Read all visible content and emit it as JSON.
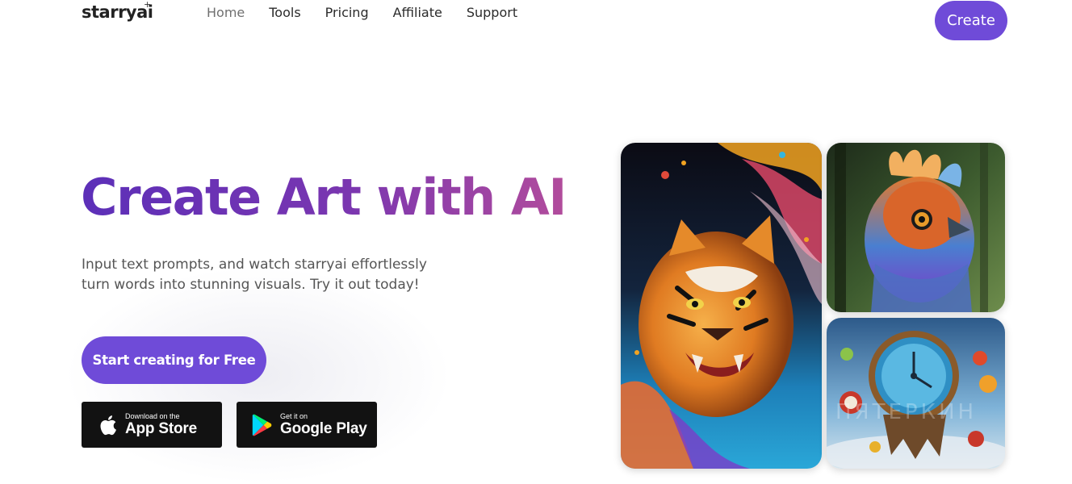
{
  "brand": {
    "name": "starryai",
    "spark": "+"
  },
  "nav": {
    "links": [
      {
        "label": "Home",
        "active": true
      },
      {
        "label": "Tools"
      },
      {
        "label": "Pricing"
      },
      {
        "label": "Affiliate"
      },
      {
        "label": "Support"
      }
    ],
    "cta_label": "Create"
  },
  "hero": {
    "title": "Create Art with AI",
    "description_lines": [
      "Input text prompts, and watch starryai effortlessly",
      "turn words into stunning visuals. Try it out today!"
    ],
    "start_label": "Start creating for Free"
  },
  "stores": {
    "apple": {
      "small": "Download on the",
      "big": "App Store",
      "icon": "apple-icon"
    },
    "google": {
      "small": "Get it on",
      "big": "Google Play",
      "icon": "google-play-icon"
    }
  },
  "gallery": [
    {
      "subject": "tiger-artwork"
    },
    {
      "subject": "bird-artwork"
    },
    {
      "subject": "clock-artwork"
    }
  ],
  "watermark": "ПЯТЕРКИН",
  "colors": {
    "accent": "#6f4bd8",
    "title_gradient_start": "#5c2fb8",
    "title_gradient_end": "#b24c9c",
    "store_bg": "#121212"
  }
}
